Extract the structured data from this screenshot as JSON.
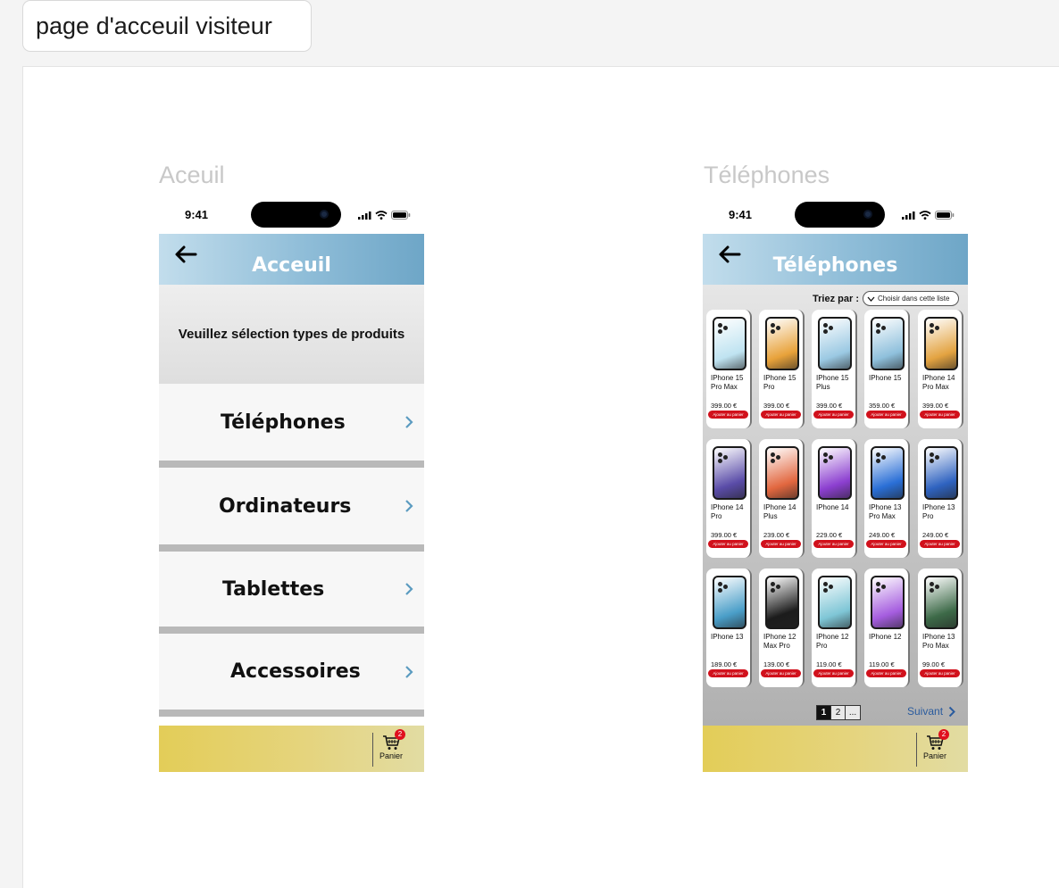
{
  "page": {
    "title": "page d'acceuil visiteur"
  },
  "status": {
    "time": "9:41"
  },
  "frame1": {
    "label": "Aceuil",
    "title": "Acceuil",
    "prompt": "Veuillez sélection types de produits",
    "categories": [
      {
        "label": "Téléphones"
      },
      {
        "label": "Ordinateurs"
      },
      {
        "label": "Tablettes"
      },
      {
        "label": "Accessoires"
      }
    ]
  },
  "frame2": {
    "label": "Téléphones",
    "title": "Téléphones",
    "sort_label": "Triez par :",
    "sort_placeholder": "Choisir dans cette liste",
    "add_label": "Ajouter au panier",
    "products": [
      {
        "name": "IPhone 15 Pro Max",
        "price": "399.00 €",
        "color": "#bfe3f1"
      },
      {
        "name": "IPhone 15 Pro",
        "price": "399.00 €",
        "color": "#e8a23a"
      },
      {
        "name": "IPhone 15 Plus",
        "price": "399.00 €",
        "color": "#9bc9e3"
      },
      {
        "name": "IPhone 15",
        "price": "359.00 €",
        "color": "#8fc0dc"
      },
      {
        "name": "IPhone 14 Pro Max",
        "price": "399.00 €",
        "color": "#e3a341"
      },
      {
        "name": "IPhone 14 Pro",
        "price": "399.00 €",
        "color": "#5a4ca8"
      },
      {
        "name": "IPhone 14 Plus",
        "price": "239.00 €",
        "color": "#e2673f"
      },
      {
        "name": "IPhone 14",
        "price": "229.00 €",
        "color": "#8c3fd0"
      },
      {
        "name": "IPhone 13 Pro Max",
        "price": "249.00 €",
        "color": "#2a6fd6"
      },
      {
        "name": "IPhone 13 Pro",
        "price": "249.00 €",
        "color": "#2f63c0"
      },
      {
        "name": "IPhone 13",
        "price": "189.00 €",
        "color": "#4a9ec8"
      },
      {
        "name": "IPhone 12 Max Pro",
        "price": "139.00 €",
        "color": "#1c1c1c"
      },
      {
        "name": "IPhone 12 Pro",
        "price": "119.00 €",
        "color": "#7fc6d6"
      },
      {
        "name": "IPhone 12",
        "price": "119.00 €",
        "color": "#a55ddf"
      },
      {
        "name": "IPhone 13 Pro Max",
        "price": "99.00 €",
        "color": "#3d6a48"
      }
    ],
    "pagination": {
      "pages": [
        "1",
        "2",
        "..."
      ],
      "next": "Suivant"
    }
  },
  "cart": {
    "label": "Panier",
    "count": "2"
  },
  "colors": {
    "header_start": "#c2ddec",
    "header_end": "#6ea6c7",
    "footer": "#e3cd58",
    "add_button": "#d1111c",
    "chevron": "#5b9bc0",
    "next_link": "#2a5b9e"
  }
}
